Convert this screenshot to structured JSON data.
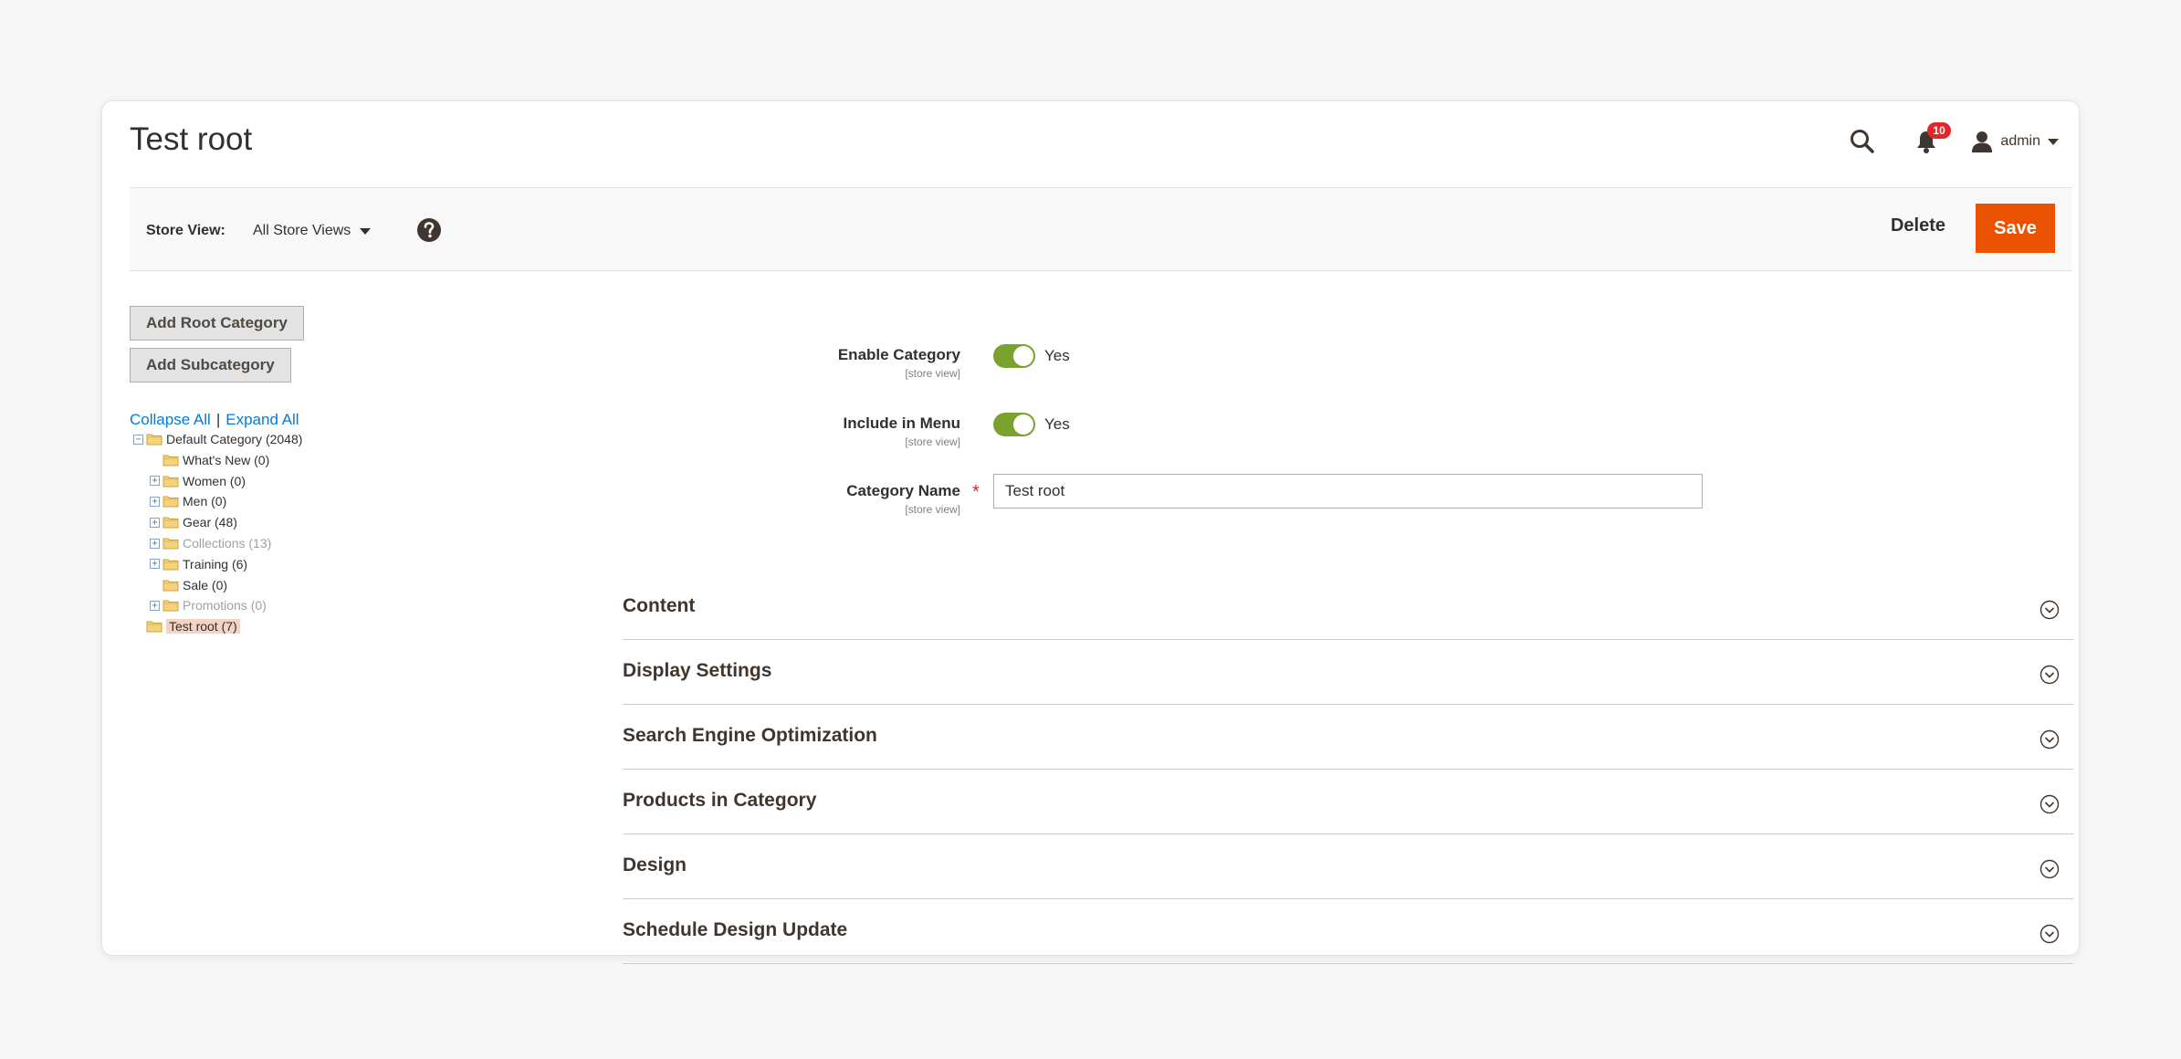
{
  "page": {
    "title": "Test root"
  },
  "header": {
    "notifications_count": "10",
    "user_name": "admin"
  },
  "toolbar": {
    "store_view_label": "Store View:",
    "store_view_value": "All Store Views",
    "delete_label": "Delete",
    "save_label": "Save"
  },
  "tree_panel": {
    "add_root_label": "Add Root Category",
    "add_sub_label": "Add Subcategory",
    "collapse_all": "Collapse All",
    "separator": "|",
    "expand_all": "Expand All",
    "nodes": [
      {
        "label": "Default Category (2048)",
        "level": 0,
        "expandable": true,
        "state": "normal"
      },
      {
        "label": "What's New (0)",
        "level": 1,
        "expandable": false,
        "state": "normal"
      },
      {
        "label": "Women (0)",
        "level": 1,
        "expandable": true,
        "state": "normal"
      },
      {
        "label": "Men (0)",
        "level": 1,
        "expandable": true,
        "state": "normal"
      },
      {
        "label": "Gear (48)",
        "level": 1,
        "expandable": true,
        "state": "normal"
      },
      {
        "label": "Collections (13)",
        "level": 1,
        "expandable": true,
        "state": "disabled"
      },
      {
        "label": "Training (6)",
        "level": 1,
        "expandable": true,
        "state": "normal"
      },
      {
        "label": "Sale (0)",
        "level": 1,
        "expandable": false,
        "state": "normal"
      },
      {
        "label": "Promotions (0)",
        "level": 1,
        "expandable": true,
        "state": "disabled"
      },
      {
        "label": "Test root (7)",
        "level": 0,
        "expandable": false,
        "state": "selected"
      }
    ]
  },
  "form": {
    "enable_category": {
      "label": "Enable Category",
      "scope": "[store view]",
      "value": "Yes"
    },
    "include_in_menu": {
      "label": "Include in Menu",
      "scope": "[store view]",
      "value": "Yes"
    },
    "category_name": {
      "label": "Category Name",
      "scope": "[store view]",
      "required": "*",
      "value": "Test root"
    }
  },
  "sections": [
    {
      "title": "Content"
    },
    {
      "title": "Display Settings"
    },
    {
      "title": "Search Engine Optimization"
    },
    {
      "title": "Products in Category"
    },
    {
      "title": "Design"
    },
    {
      "title": "Schedule Design Update"
    }
  ],
  "colors": {
    "accent": "#eb5202",
    "toggle_on": "#79a22e",
    "link": "#007bdb",
    "badge": "#e22626",
    "selected_node": "#f4d2c4"
  }
}
